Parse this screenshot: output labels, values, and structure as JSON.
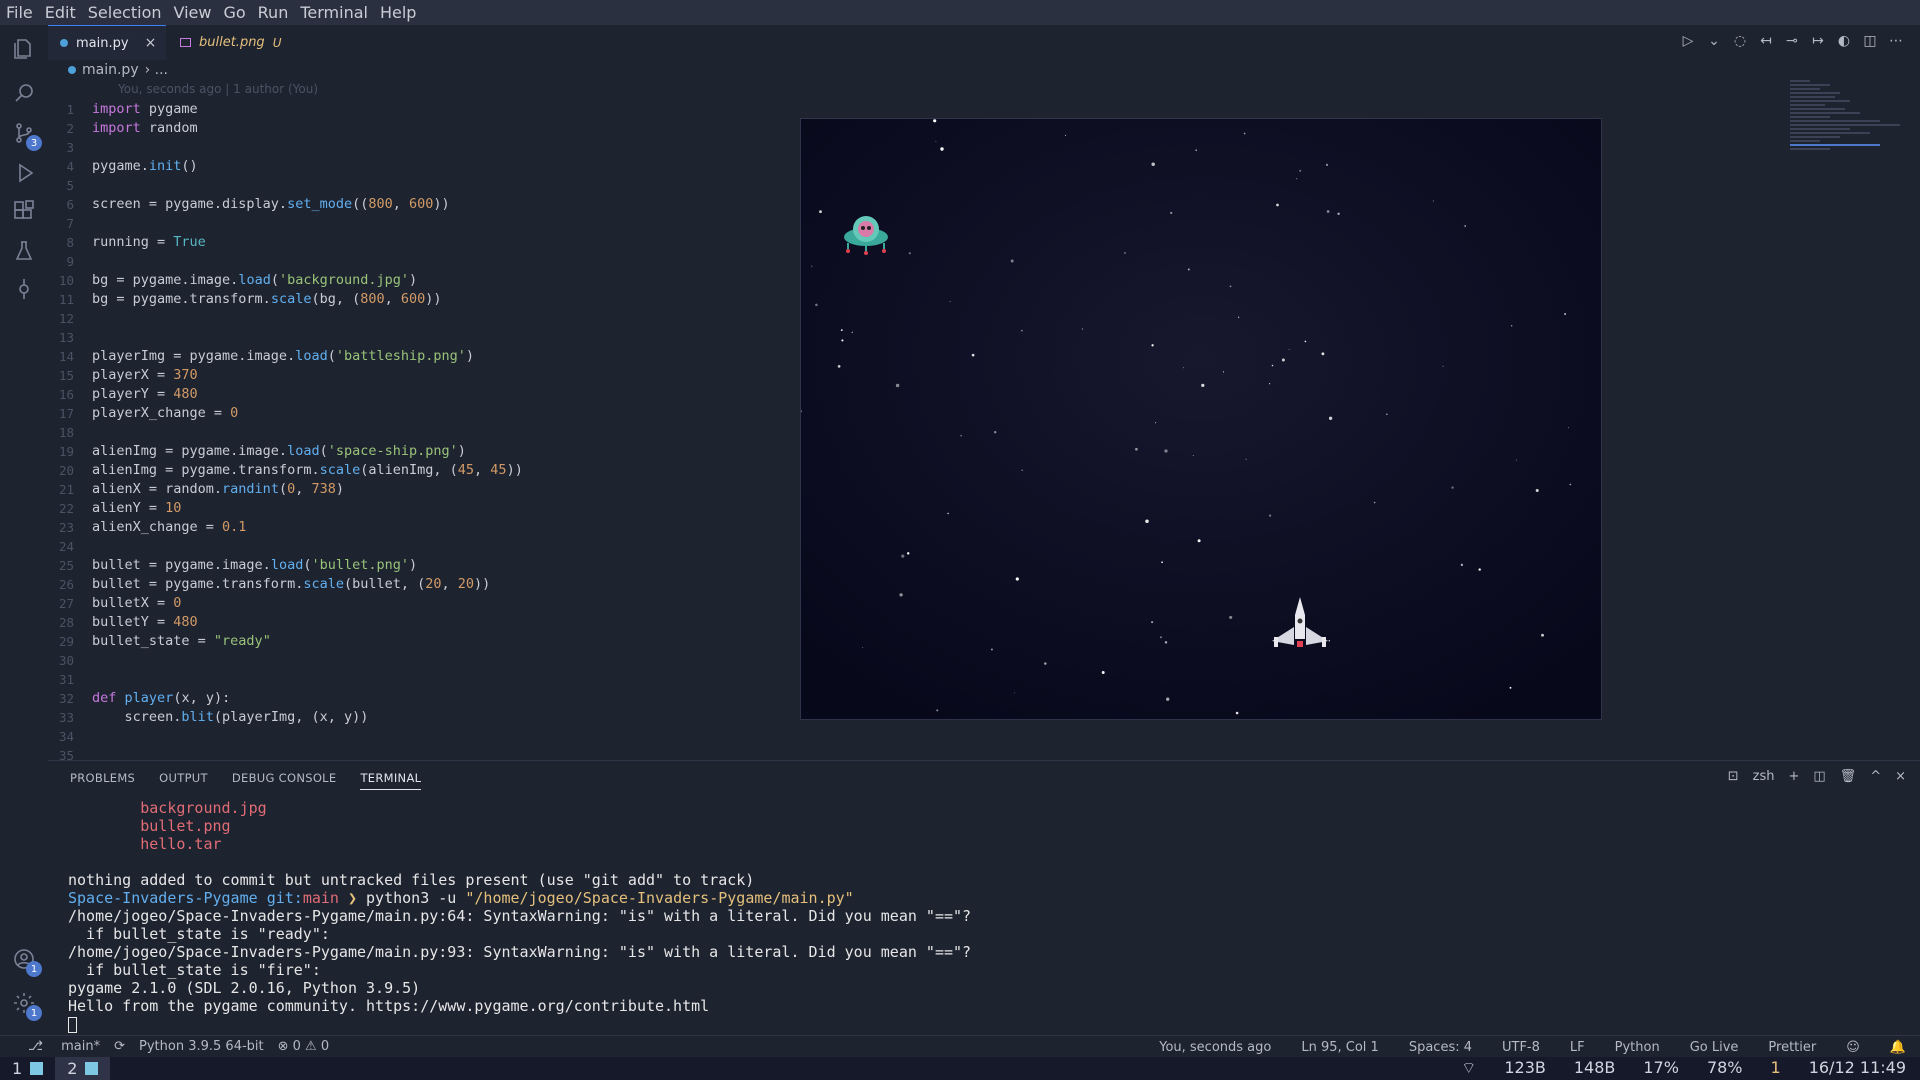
{
  "menu": [
    "File",
    "Edit",
    "Selection",
    "View",
    "Go",
    "Run",
    "Terminal",
    "Help"
  ],
  "activity_badges": {
    "source_control": "3",
    "accounts": "1",
    "settings": "1"
  },
  "tabs": [
    {
      "label": "main.py",
      "close": "×"
    },
    {
      "label": "bullet.png",
      "status": "U"
    }
  ],
  "breadcrumb": {
    "file": "main.py",
    "rest": "› ..."
  },
  "blame": "You, seconds ago | 1 author (You)",
  "code_lines": [
    {
      "n": "1",
      "html": "<span class=\"kw\">import</span> pygame"
    },
    {
      "n": "2",
      "html": "<span class=\"kw\">import</span> random"
    },
    {
      "n": "3",
      "html": ""
    },
    {
      "n": "4",
      "html": "pygame.<span class=\"fn\">init</span>()"
    },
    {
      "n": "5",
      "html": ""
    },
    {
      "n": "6",
      "html": "screen = pygame.display.<span class=\"fn\">set_mode</span>((<span class=\"num\">800</span>, <span class=\"num\">600</span>))"
    },
    {
      "n": "7",
      "html": ""
    },
    {
      "n": "8",
      "html": "running = <span class=\"cst\">True</span>"
    },
    {
      "n": "9",
      "html": ""
    },
    {
      "n": "10",
      "html": "bg = pygame.image.<span class=\"fn\">load</span>(<span class=\"str\">'background.jpg'</span>)"
    },
    {
      "n": "11",
      "html": "bg = pygame.transform.<span class=\"fn\">scale</span>(bg, (<span class=\"num\">800</span>, <span class=\"num\">600</span>))"
    },
    {
      "n": "12",
      "html": ""
    },
    {
      "n": "13",
      "html": ""
    },
    {
      "n": "14",
      "html": "playerImg = pygame.image.<span class=\"fn\">load</span>(<span class=\"str\">'battleship.png'</span>)"
    },
    {
      "n": "15",
      "html": "playerX = <span class=\"num\">370</span>"
    },
    {
      "n": "16",
      "html": "playerY = <span class=\"num\">480</span>"
    },
    {
      "n": "17",
      "html": "playerX_change = <span class=\"num\">0</span>"
    },
    {
      "n": "18",
      "html": ""
    },
    {
      "n": "19",
      "html": "alienImg = pygame.image.<span class=\"fn\">load</span>(<span class=\"str\">'space-ship.png'</span>)"
    },
    {
      "n": "20",
      "html": "alienImg = pygame.transform.<span class=\"fn\">scale</span>(alienImg, (<span class=\"num\">45</span>, <span class=\"num\">45</span>))"
    },
    {
      "n": "21",
      "html": "alienX = random.<span class=\"fn\">randint</span>(<span class=\"num\">0</span>, <span class=\"num\">738</span>)"
    },
    {
      "n": "22",
      "html": "alienY = <span class=\"num\">10</span>"
    },
    {
      "n": "23",
      "html": "alienX_change = <span class=\"num\">0.1</span>"
    },
    {
      "n": "24",
      "html": ""
    },
    {
      "n": "25",
      "html": "bullet = pygame.image.<span class=\"fn\">load</span>(<span class=\"str\">'bullet.png'</span>)"
    },
    {
      "n": "26",
      "html": "bullet = pygame.transform.<span class=\"fn\">scale</span>(bullet, (<span class=\"num\">20</span>, <span class=\"num\">20</span>))"
    },
    {
      "n": "27",
      "html": "bulletX = <span class=\"num\">0</span>"
    },
    {
      "n": "28",
      "html": "bulletY = <span class=\"num\">480</span>"
    },
    {
      "n": "29",
      "html": "bullet_state = <span class=\"str\">\"ready\"</span>"
    },
    {
      "n": "30",
      "html": ""
    },
    {
      "n": "31",
      "html": ""
    },
    {
      "n": "32",
      "html": "<span class=\"kw\">def</span> <span class=\"fn\">player</span>(x, y):"
    },
    {
      "n": "33",
      "html": "    screen.<span class=\"fn\">blit</span>(playerImg, (x, y))"
    },
    {
      "n": "34",
      "html": ""
    },
    {
      "n": "35",
      "html": ""
    }
  ],
  "panel": {
    "tabs": [
      "PROBLEMS",
      "OUTPUT",
      "DEBUG CONSOLE",
      "TERMINAL"
    ],
    "shell": "zsh"
  },
  "terminal_lines": [
    {
      "cls": "t-red",
      "text": "        background.jpg"
    },
    {
      "cls": "t-red",
      "text": "        bullet.png"
    },
    {
      "cls": "t-red",
      "text": "        hello.tar"
    },
    {
      "cls": "",
      "text": ""
    },
    {
      "cls": "",
      "text": "nothing added to commit but untracked files present (use \"git add\" to track)"
    },
    {
      "cls": "prompt",
      "text": ""
    },
    {
      "cls": "",
      "text": "/home/jogeo/Space-Invaders-Pygame/main.py:64: SyntaxWarning: \"is\" with a literal. Did you mean \"==\"?"
    },
    {
      "cls": "",
      "text": "  if bullet_state is \"ready\":"
    },
    {
      "cls": "",
      "text": "/home/jogeo/Space-Invaders-Pygame/main.py:93: SyntaxWarning: \"is\" with a literal. Did you mean \"==\"?"
    },
    {
      "cls": "",
      "text": "  if bullet_state is \"fire\":"
    },
    {
      "cls": "",
      "text": "pygame 2.1.0 (SDL 2.0.16, Python 3.9.5)"
    },
    {
      "cls": "",
      "text": "Hello from the pygame community. https://www.pygame.org/contribute.html"
    }
  ],
  "prompt": {
    "dir": "Space-Invaders-Pygame",
    "git": "git:",
    "branch": "main",
    "arrow": " ❯ ",
    "cmd": "python3 -u ",
    "arg": "\"/home/jogeo/Space-Invaders-Pygame/main.py\""
  },
  "status": {
    "branch": "main*",
    "python": "Python 3.9.5 64-bit",
    "problems": "⊗ 0 ⚠ 0",
    "blame": "You, seconds ago",
    "position": "Ln 95, Col 1",
    "spaces": "Spaces: 4",
    "encoding": "UTF-8",
    "eol": "LF",
    "language": "Python",
    "golive": "Go Live",
    "prettier": "Prettier"
  },
  "taskbar": {
    "ws1": "1",
    "ws2": "2",
    "down": "123B",
    "up": "148B",
    "cpu": "17%",
    "battery": "78%",
    "notif": "1",
    "datetime": "16/12 11:49"
  }
}
